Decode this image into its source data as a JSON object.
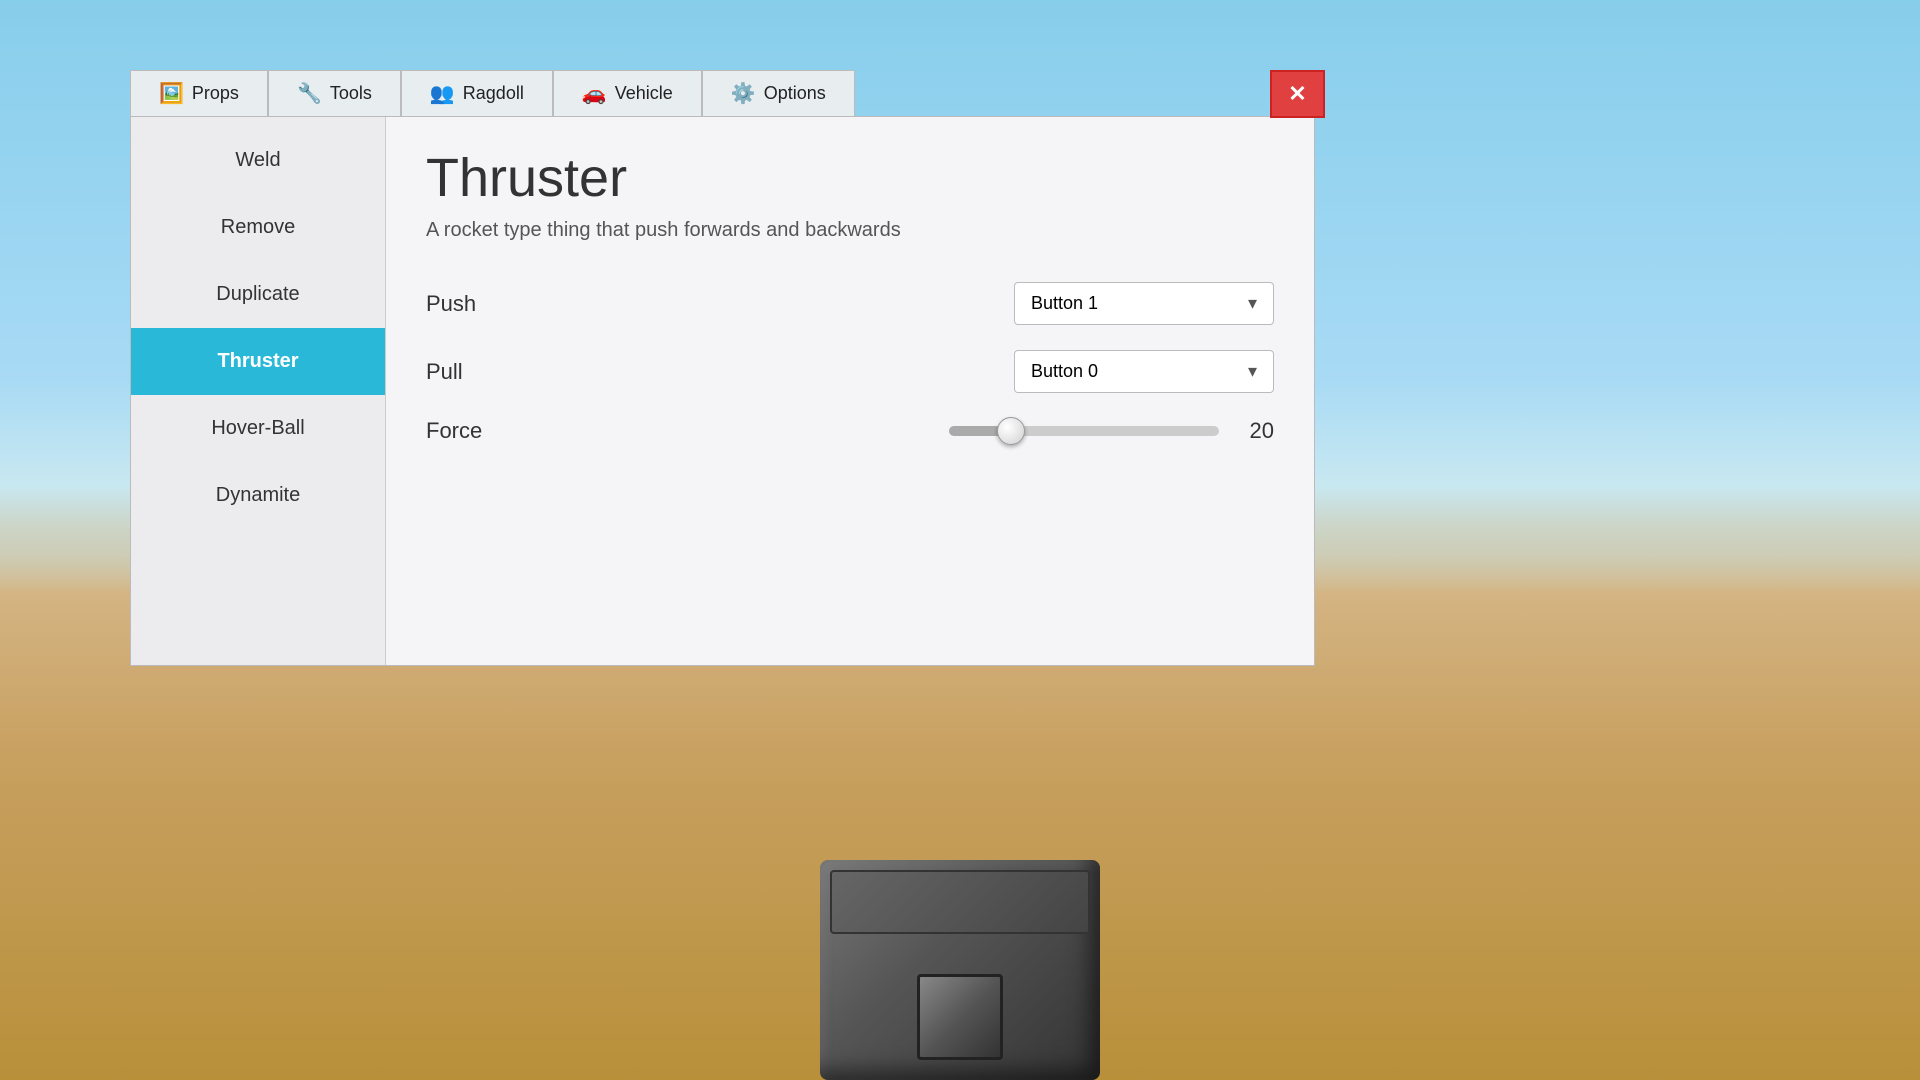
{
  "background": {
    "description": "Desert/sky scene"
  },
  "tabs": [
    {
      "id": "props",
      "label": "Props",
      "icon": "🖼️"
    },
    {
      "id": "tools",
      "label": "Tools",
      "icon": "🔧"
    },
    {
      "id": "ragdoll",
      "label": "Ragdoll",
      "icon": "👥"
    },
    {
      "id": "vehicle",
      "label": "Vehicle",
      "icon": "🚗"
    },
    {
      "id": "options",
      "label": "Options",
      "icon": "⚙️"
    }
  ],
  "close_button": "✕",
  "sidebar": {
    "items": [
      {
        "id": "weld",
        "label": "Weld",
        "active": false
      },
      {
        "id": "remove",
        "label": "Remove",
        "active": false
      },
      {
        "id": "duplicate",
        "label": "Duplicate",
        "active": false
      },
      {
        "id": "thruster",
        "label": "Thruster",
        "active": true
      },
      {
        "id": "hoverball",
        "label": "Hover-Ball",
        "active": false
      },
      {
        "id": "dynamite",
        "label": "Dynamite",
        "active": false
      }
    ]
  },
  "detail": {
    "title": "Thruster",
    "description": "A rocket type thing that push forwards and backwards",
    "controls": [
      {
        "id": "push",
        "label": "Push",
        "type": "dropdown",
        "value": "Button 1"
      },
      {
        "id": "pull",
        "label": "Pull",
        "type": "dropdown",
        "value": "Button 0"
      },
      {
        "id": "force",
        "label": "Force",
        "type": "slider",
        "value": 20,
        "min": 0,
        "max": 100,
        "percent": 23
      }
    ]
  }
}
